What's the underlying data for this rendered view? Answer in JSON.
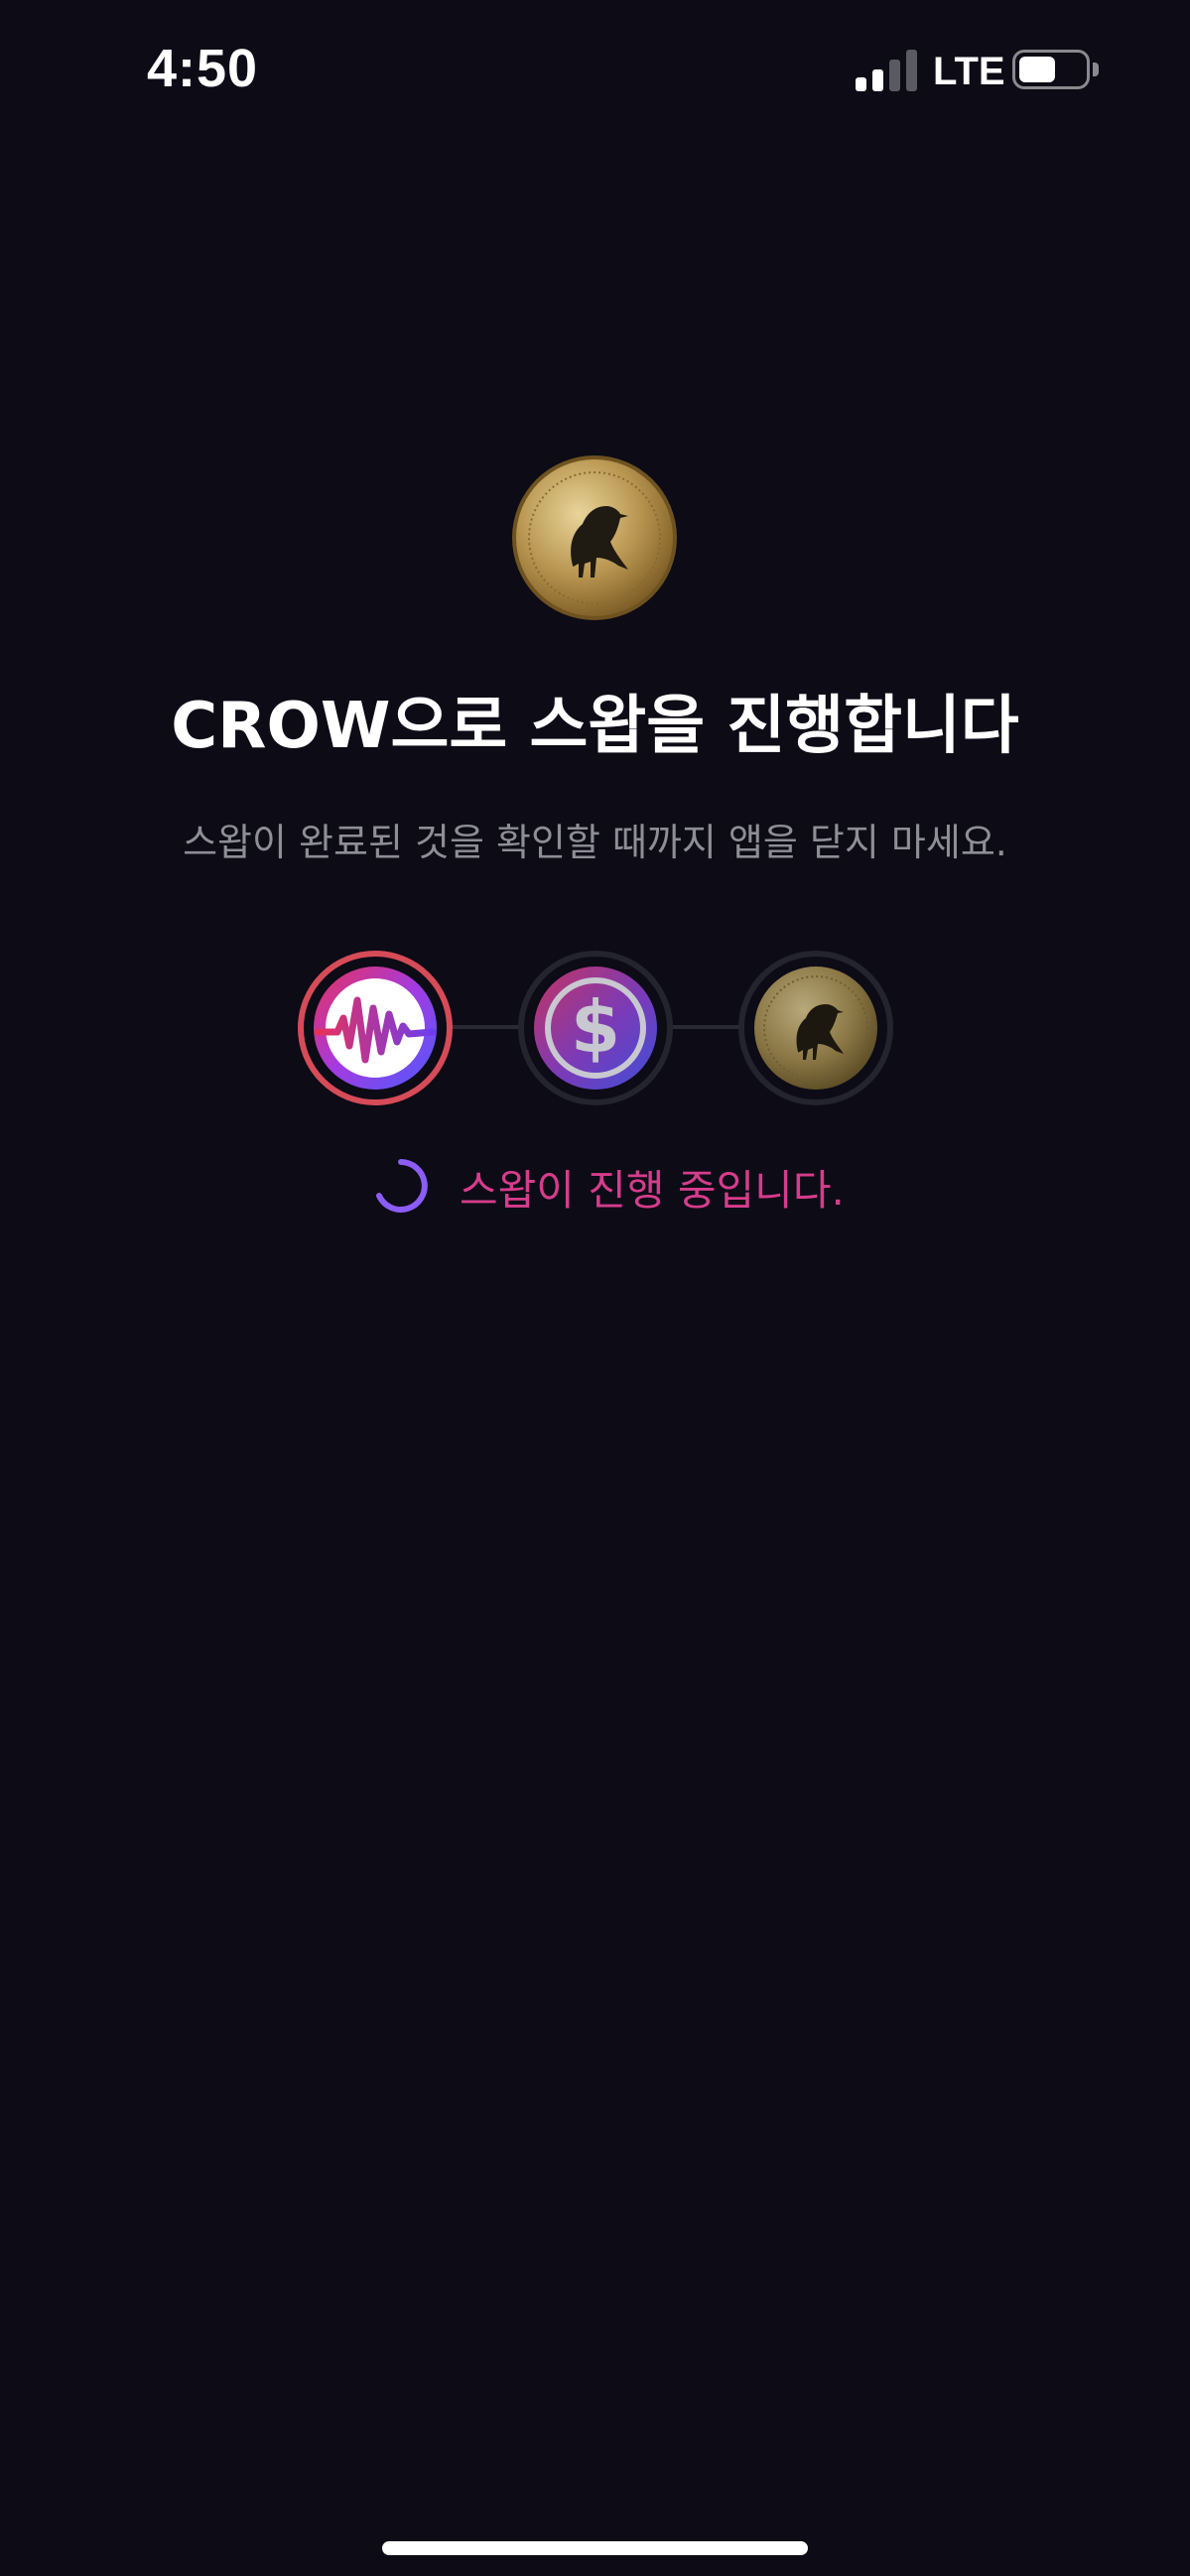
{
  "status_bar": {
    "time": "4:50",
    "network": "LTE",
    "signal_bars_active": 2,
    "signal_bars_total": 4,
    "battery_level": 0.55
  },
  "swap": {
    "title": "CROW으로 스왑을 진행합니다",
    "subtitle": "스왑이 완료된 것을 확인할 때까지 앱을 닫지 마세요.",
    "steps": [
      {
        "icon": "wemix-token-icon",
        "state": "active"
      },
      {
        "icon": "wemix-dollar-token-icon",
        "state": "pending"
      },
      {
        "icon": "crow-token-icon",
        "state": "pending"
      }
    ],
    "progress_text": "스왑이 진행 중입니다."
  },
  "colors": {
    "background": "#0c0b16",
    "active_ring": "#d64b58",
    "progress_text": "#d63c8c",
    "spinner": "#8b5cf6",
    "subtitle": "#8e8e96"
  }
}
